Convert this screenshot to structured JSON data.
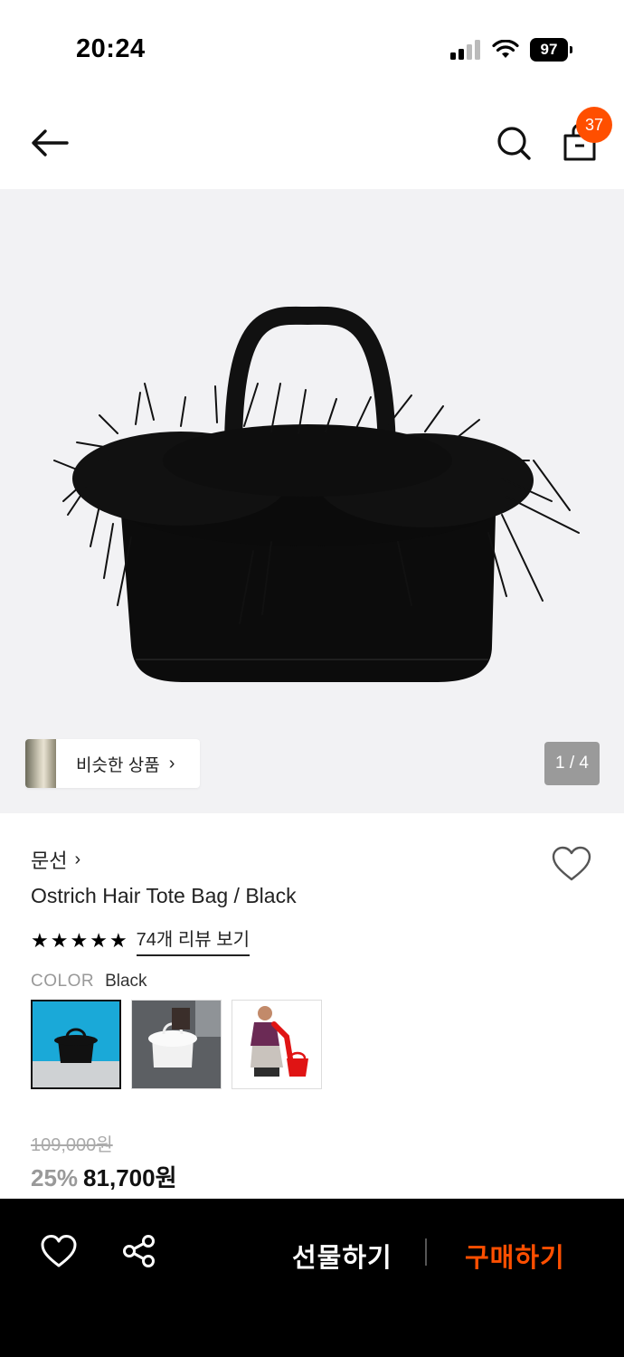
{
  "status_bar": {
    "time": "20:24",
    "battery": "97"
  },
  "nav": {
    "cart_count": "37"
  },
  "hero": {
    "similar_label": "비슷한 상품",
    "page_indicator": "1 / 4"
  },
  "product": {
    "brand": "문선",
    "title": "Ostrich Hair Tote Bag / Black",
    "rating_stars": 5,
    "review_link": "74개 리뷰 보기",
    "color_key": "COLOR",
    "color_value": "Black",
    "original_price": "109,000원",
    "discount": "25%",
    "sale_price": "81,700원"
  },
  "bottom_bar": {
    "gift_label": "선물하기",
    "buy_label": "구매하기"
  },
  "colors": {
    "accent": "#ff4f00",
    "bar": "#000000",
    "hero_bg": "#f2f2f4"
  },
  "icons": [
    "back-arrow-icon",
    "search-icon",
    "shopping-bag-icon",
    "heart-icon",
    "share-icon",
    "star-icon",
    "chevron-right-icon",
    "wifi-icon",
    "signal-icon",
    "battery-icon"
  ]
}
